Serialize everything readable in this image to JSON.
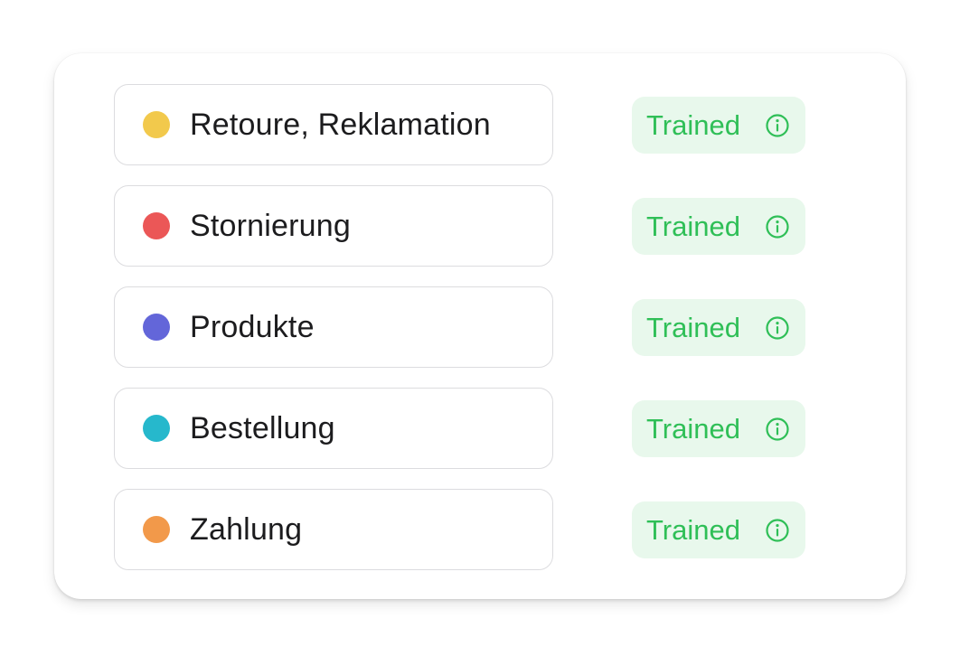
{
  "intents": [
    {
      "label": "Retoure, Reklamation",
      "color": "#f2c94c",
      "status": "Trained",
      "status_icon": "info-icon"
    },
    {
      "label": "Stornierung",
      "color": "#eb5757",
      "status": "Trained",
      "status_icon": "info-icon"
    },
    {
      "label": "Produkte",
      "color": "#6366d9",
      "status": "Trained",
      "status_icon": "info-icon"
    },
    {
      "label": "Bestellung",
      "color": "#26b8cc",
      "status": "Trained",
      "status_icon": "info-icon"
    },
    {
      "label": "Zahlung",
      "color": "#f2994a",
      "status": "Trained",
      "status_icon": "info-icon"
    }
  ],
  "colors": {
    "status_text": "#2fbf57",
    "status_background": "#e8f8ec"
  }
}
